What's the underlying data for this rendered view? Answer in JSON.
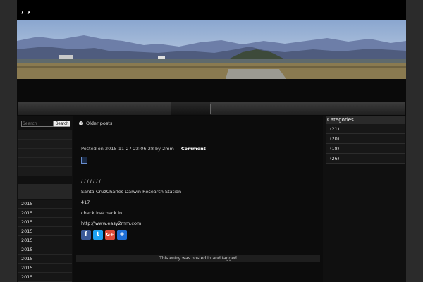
{
  "site": {
    "title": ", ,"
  },
  "search": {
    "placeholder": "Search",
    "button": "Search"
  },
  "archives": [
    "2015",
    "2015",
    "2015",
    "2015",
    "2015",
    "2015",
    "2015",
    "2015",
    "2015"
  ],
  "post": {
    "older_posts": "Older posts",
    "meta": "Posted on 2015-11-27 22:06:28 by 2mm",
    "comment": "Comment",
    "slashes": "/ / / / / / /",
    "line1": "Santa CruzCharles Darwin Research Station",
    "line2": "417",
    "line3": "check in4check in",
    "line4": "http://www.easy2mm.com",
    "footer": "This entry was posted in  and tagged"
  },
  "share": [
    {
      "name": "facebook",
      "glyph": "f",
      "color": "#3b5998"
    },
    {
      "name": "twitter",
      "glyph": "t",
      "color": "#1da1f2"
    },
    {
      "name": "google-plus",
      "glyph": "G+",
      "color": "#dd4b39"
    },
    {
      "name": "share",
      "glyph": "+",
      "color": "#1f6fd6"
    }
  ],
  "categories": {
    "title": "Categories",
    "items": [
      "(21)",
      "(20)",
      "(18)",
      "(26)"
    ]
  }
}
